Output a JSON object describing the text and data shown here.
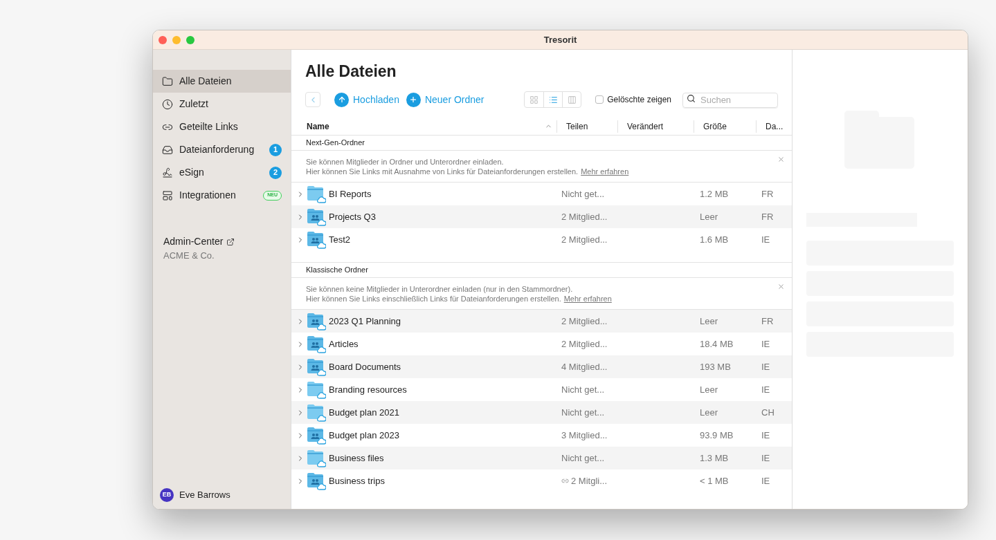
{
  "window": {
    "title": "Tresorit"
  },
  "sidebar": {
    "items": [
      {
        "label": "Alle Dateien",
        "selected": true
      },
      {
        "label": "Zuletzt",
        "selected": false
      },
      {
        "label": "Geteilte Links",
        "selected": false
      },
      {
        "label": "Dateianforderung",
        "selected": false,
        "badge": {
          "text": "1",
          "kind": "count"
        }
      },
      {
        "label": "eSign",
        "selected": false,
        "badge": {
          "text": "2",
          "kind": "count"
        }
      },
      {
        "label": "Integrationen",
        "selected": false,
        "badge": {
          "text": "NEU",
          "kind": "new"
        }
      }
    ],
    "admin": {
      "label": "Admin-Center",
      "company": "ACME & Co."
    },
    "user": {
      "initials": "EB",
      "name": "Eve Barrows"
    }
  },
  "main": {
    "title": "Alle Dateien",
    "toolbar": {
      "upload": "Hochladen",
      "new_folder": "Neuer Ordner",
      "views": [
        {
          "selected": false
        },
        {
          "selected": true
        },
        {
          "selected": false
        }
      ],
      "show_deleted": {
        "label": "Gelöschte zeigen",
        "checked": false
      },
      "search": {
        "placeholder": "Suchen"
      }
    },
    "columns": [
      "Name",
      "Teilen",
      "Verändert",
      "Größe",
      "Da..."
    ],
    "sections": [
      {
        "title": "Next-Gen-Ordner",
        "notice": [
          "Sie können Mitglieder in Ordner und Unterordner einladen.",
          "Hier können Sie Links mit Ausnahme von Links für Dateianforderungen erstellen."
        ],
        "link": "Mehr erfahren",
        "rows": [
          {
            "name": "BI Reports",
            "kind": "plain",
            "share": "Nicht get...",
            "size": "1.2 MB",
            "dc": "FR"
          },
          {
            "name": "Projects Q3",
            "kind": "shared",
            "share": "2 Mitglied...",
            "size": "Leer",
            "dc": "FR"
          },
          {
            "name": "Test2",
            "kind": "shared",
            "share": "2 Mitglied...",
            "size": "1.6 MB",
            "dc": "IE"
          }
        ]
      },
      {
        "title": "Klassische Ordner",
        "notice": [
          "Sie können keine Mitglieder in Unterordner einladen (nur in den Stammordner).",
          "Hier können Sie Links einschließlich Links für Dateianforderungen erstellen."
        ],
        "link": "Mehr erfahren",
        "rows": [
          {
            "name": "2023 Q1 Planning",
            "kind": "shared",
            "share": "2 Mitglied...",
            "size": "Leer",
            "dc": "FR"
          },
          {
            "name": "Articles",
            "kind": "shared",
            "share": "2 Mitglied...",
            "size": "18.4 MB",
            "dc": "IE"
          },
          {
            "name": "Board Documents",
            "kind": "shared",
            "share": "4 Mitglied...",
            "size": "193 MB",
            "dc": "IE"
          },
          {
            "name": "Branding resources",
            "kind": "plain",
            "share": "Nicht get...",
            "size": "Leer",
            "dc": "IE"
          },
          {
            "name": "Budget plan 2021",
            "kind": "plain",
            "share": "Nicht get...",
            "size": "Leer",
            "dc": "CH"
          },
          {
            "name": "Budget plan 2023",
            "kind": "shared",
            "share": "3 Mitglied...",
            "size": "93.9 MB",
            "dc": "IE"
          },
          {
            "name": "Business files",
            "kind": "plain",
            "share": "Nicht get...",
            "size": "1.3 MB",
            "dc": "IE"
          },
          {
            "name": "Business trips",
            "kind": "shared",
            "share": "2 Mitgli...",
            "link": true,
            "size": "< 1 MB",
            "dc": "IE"
          }
        ]
      }
    ]
  }
}
